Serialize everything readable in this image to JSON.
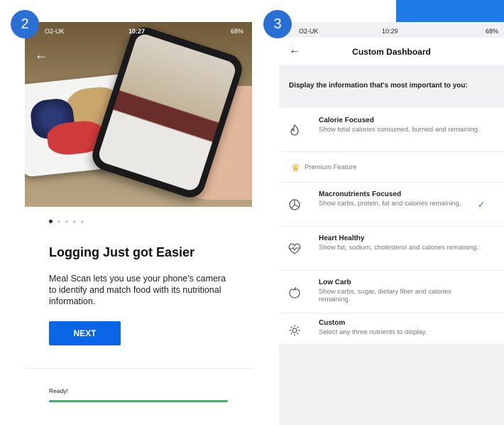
{
  "badges": {
    "left": "2",
    "right": "3"
  },
  "phone1": {
    "status": {
      "carrier": "O2-UK",
      "time": "10:27",
      "battery": "68%"
    },
    "back_icon": "arrow-left-icon",
    "headline": "Logging Just got Easier",
    "body": "Meal Scan lets you use your phone's camera to identify and match food with its nutritional information.",
    "next_label": "NEXT",
    "progress_label": "Ready!",
    "progress_fraction": 1.0,
    "pager": {
      "count": 5,
      "active": 0
    }
  },
  "phone2": {
    "status": {
      "carrier": "O2-UK",
      "time": "10:29",
      "battery": "68%"
    },
    "title": "Custom Dashboard",
    "intro": "Display the information that's most important to you:",
    "premium_label": "Premium Feature",
    "options": [
      {
        "icon": "flame-icon",
        "title": "Calorie Focused",
        "desc": "Show total calories consumed, burned and remaining.",
        "selected": false
      },
      {
        "icon": "pie-chart-icon",
        "title": "Macronutrients Focused",
        "desc": "Show carbs, protein, fat and calories remaining.",
        "selected": true
      },
      {
        "icon": "heart-rate-icon",
        "title": "Heart Healthy",
        "desc": "Show fat, sodium, cholesterol and calories remaining.",
        "selected": false
      },
      {
        "icon": "apple-icon",
        "title": "Low Carb",
        "desc": "Show carbs, sugar, dietary fiber and calories remaining.",
        "selected": false
      },
      {
        "icon": "gear-icon",
        "title": "Custom",
        "desc": "Select any three nutrients to display.",
        "selected": false
      }
    ]
  },
  "colors": {
    "accent": "#0a66e6",
    "badge": "#2a6fd6",
    "progress": "#2bbf5e",
    "check": "#1e6fd6",
    "crown": "#e8b01a"
  }
}
